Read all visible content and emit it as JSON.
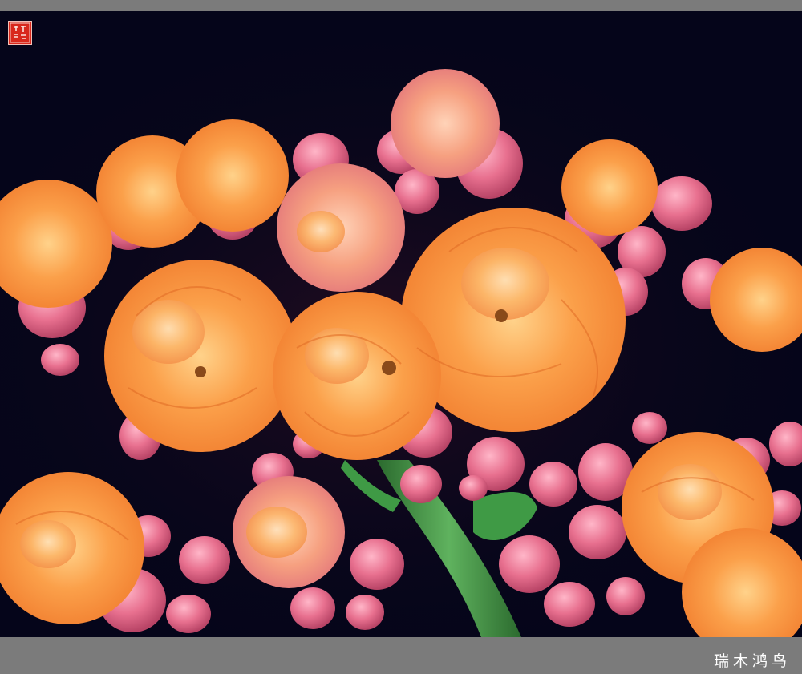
{
  "photo": {
    "subject": "kalanchoe-blossom-cluster",
    "background_color": "#06061a",
    "petal_orange": "#f7913a",
    "petal_light_orange": "#fbb864",
    "bud_pink": "#e86d8f",
    "stem_green": "#3a8a3e"
  },
  "signature": {
    "text": "瑞木鸿鸟"
  },
  "seal": {
    "text": "瑞木鸿鸟",
    "color": "#d8281c"
  },
  "frame": {
    "color": "#7b7b7b"
  }
}
